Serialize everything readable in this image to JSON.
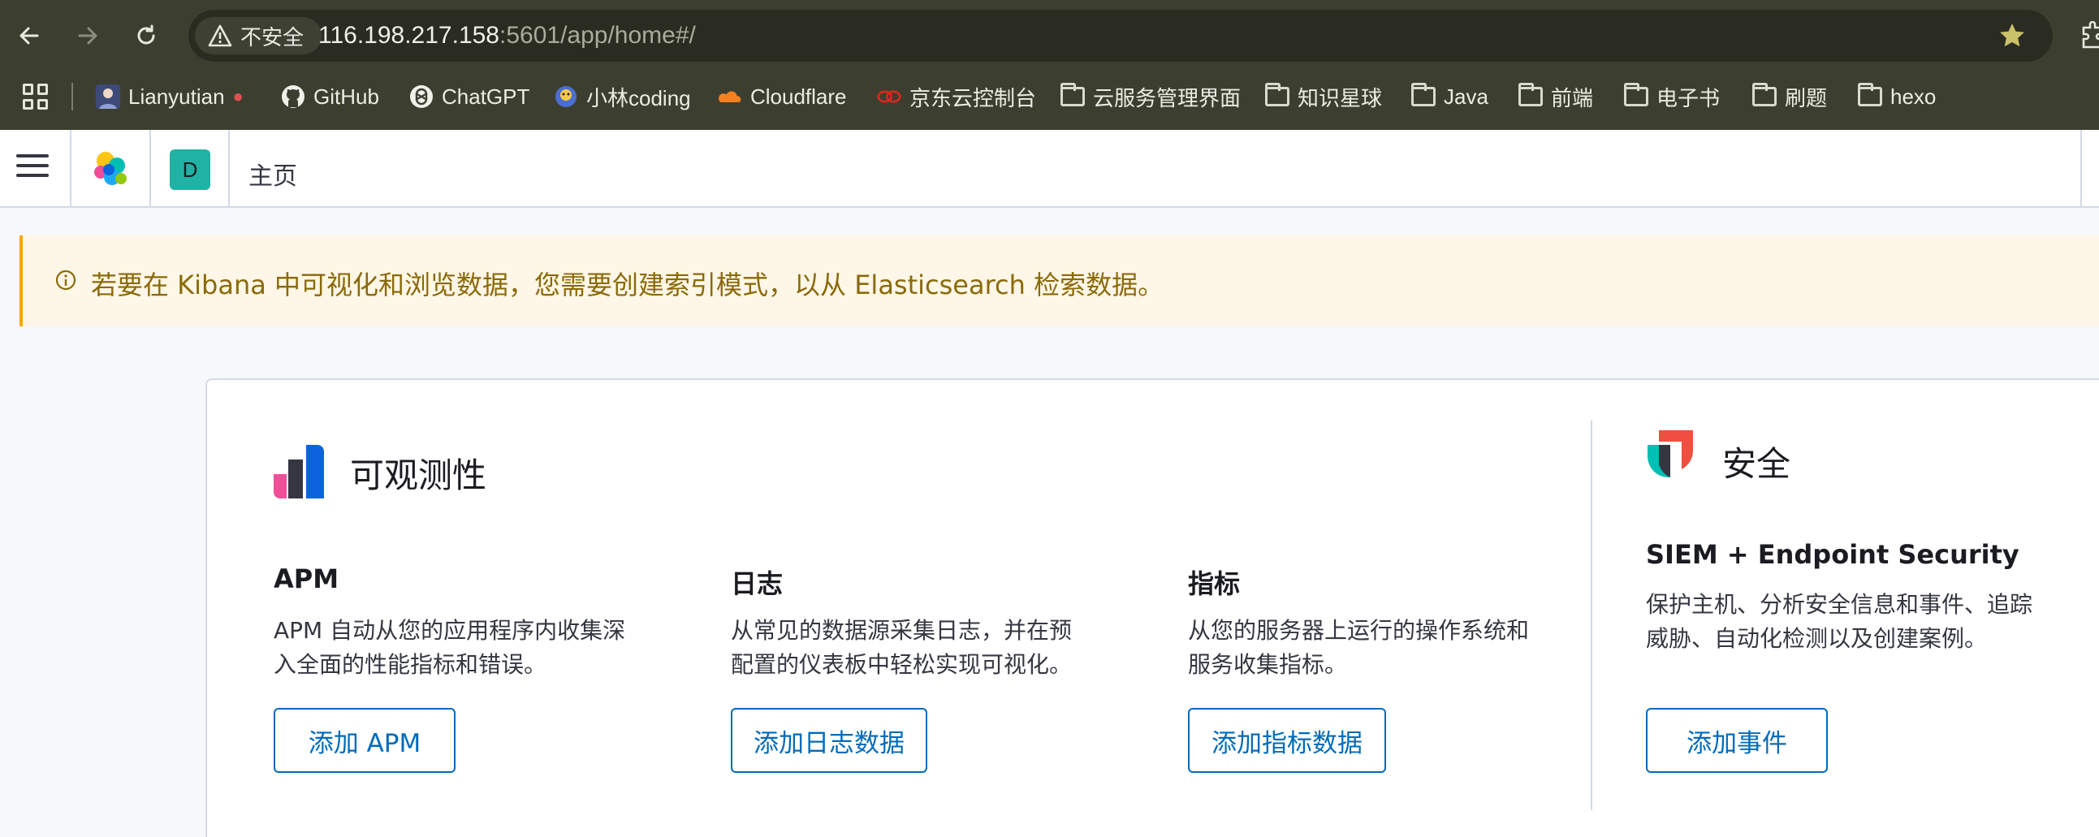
{
  "browser": {
    "security_chip": "不安全",
    "url_host": "116.198.217.158",
    "url_path": ":5601/app/home#/",
    "bookmarks": [
      {
        "label": "Lianyutian",
        "icon": "avatar-icon"
      },
      {
        "label": "GitHub",
        "icon": "github-icon"
      },
      {
        "label": "ChatGPT",
        "icon": "chatgpt-icon"
      },
      {
        "label": "小林coding",
        "icon": "xiaolin-icon"
      },
      {
        "label": "Cloudflare",
        "icon": "cloudflare-icon"
      },
      {
        "label": "京东云控制台",
        "icon": "jdcloud-icon"
      },
      {
        "label": "云服务管理界面",
        "icon": "folder-icon"
      },
      {
        "label": "知识星球",
        "icon": "folder-icon"
      },
      {
        "label": "Java",
        "icon": "folder-icon"
      },
      {
        "label": "前端",
        "icon": "folder-icon"
      },
      {
        "label": "电子书",
        "icon": "folder-icon"
      },
      {
        "label": "刷题",
        "icon": "folder-icon"
      },
      {
        "label": "hexo",
        "icon": "folder-icon"
      }
    ]
  },
  "header": {
    "space_initial": "D",
    "breadcrumb": "主页"
  },
  "callout": {
    "text": "若要在 Kibana 中可视化和浏览数据，您需要创建索引模式，以从 Elasticsearch 检索数据。"
  },
  "observability": {
    "title": "可观测性",
    "cards": [
      {
        "title": "APM",
        "desc": "APM 自动从您的应用程序内收集深入全面的性能指标和错误。",
        "button": "添加 APM"
      },
      {
        "title": "日志",
        "desc": "从常见的数据源采集日志，并在预配置的仪表板中轻松实现可视化。",
        "button": "添加日志数据"
      },
      {
        "title": "指标",
        "desc": "从您的服务器上运行的操作系统和服务收集指标。",
        "button": "添加指标数据"
      }
    ]
  },
  "security": {
    "title": "安全",
    "card": {
      "title": "SIEM + Endpoint Security",
      "desc": "保护主机、分析安全信息和事件、追踪威胁、自动化检测以及创建案例。",
      "button": "添加事件"
    }
  },
  "colors": {
    "chrome_bg": "#3c3f30",
    "accent": "#006bb8",
    "callout_bg": "#fef6e6",
    "callout_border": "#f5a700",
    "space_avatar": "#20b2a4"
  }
}
